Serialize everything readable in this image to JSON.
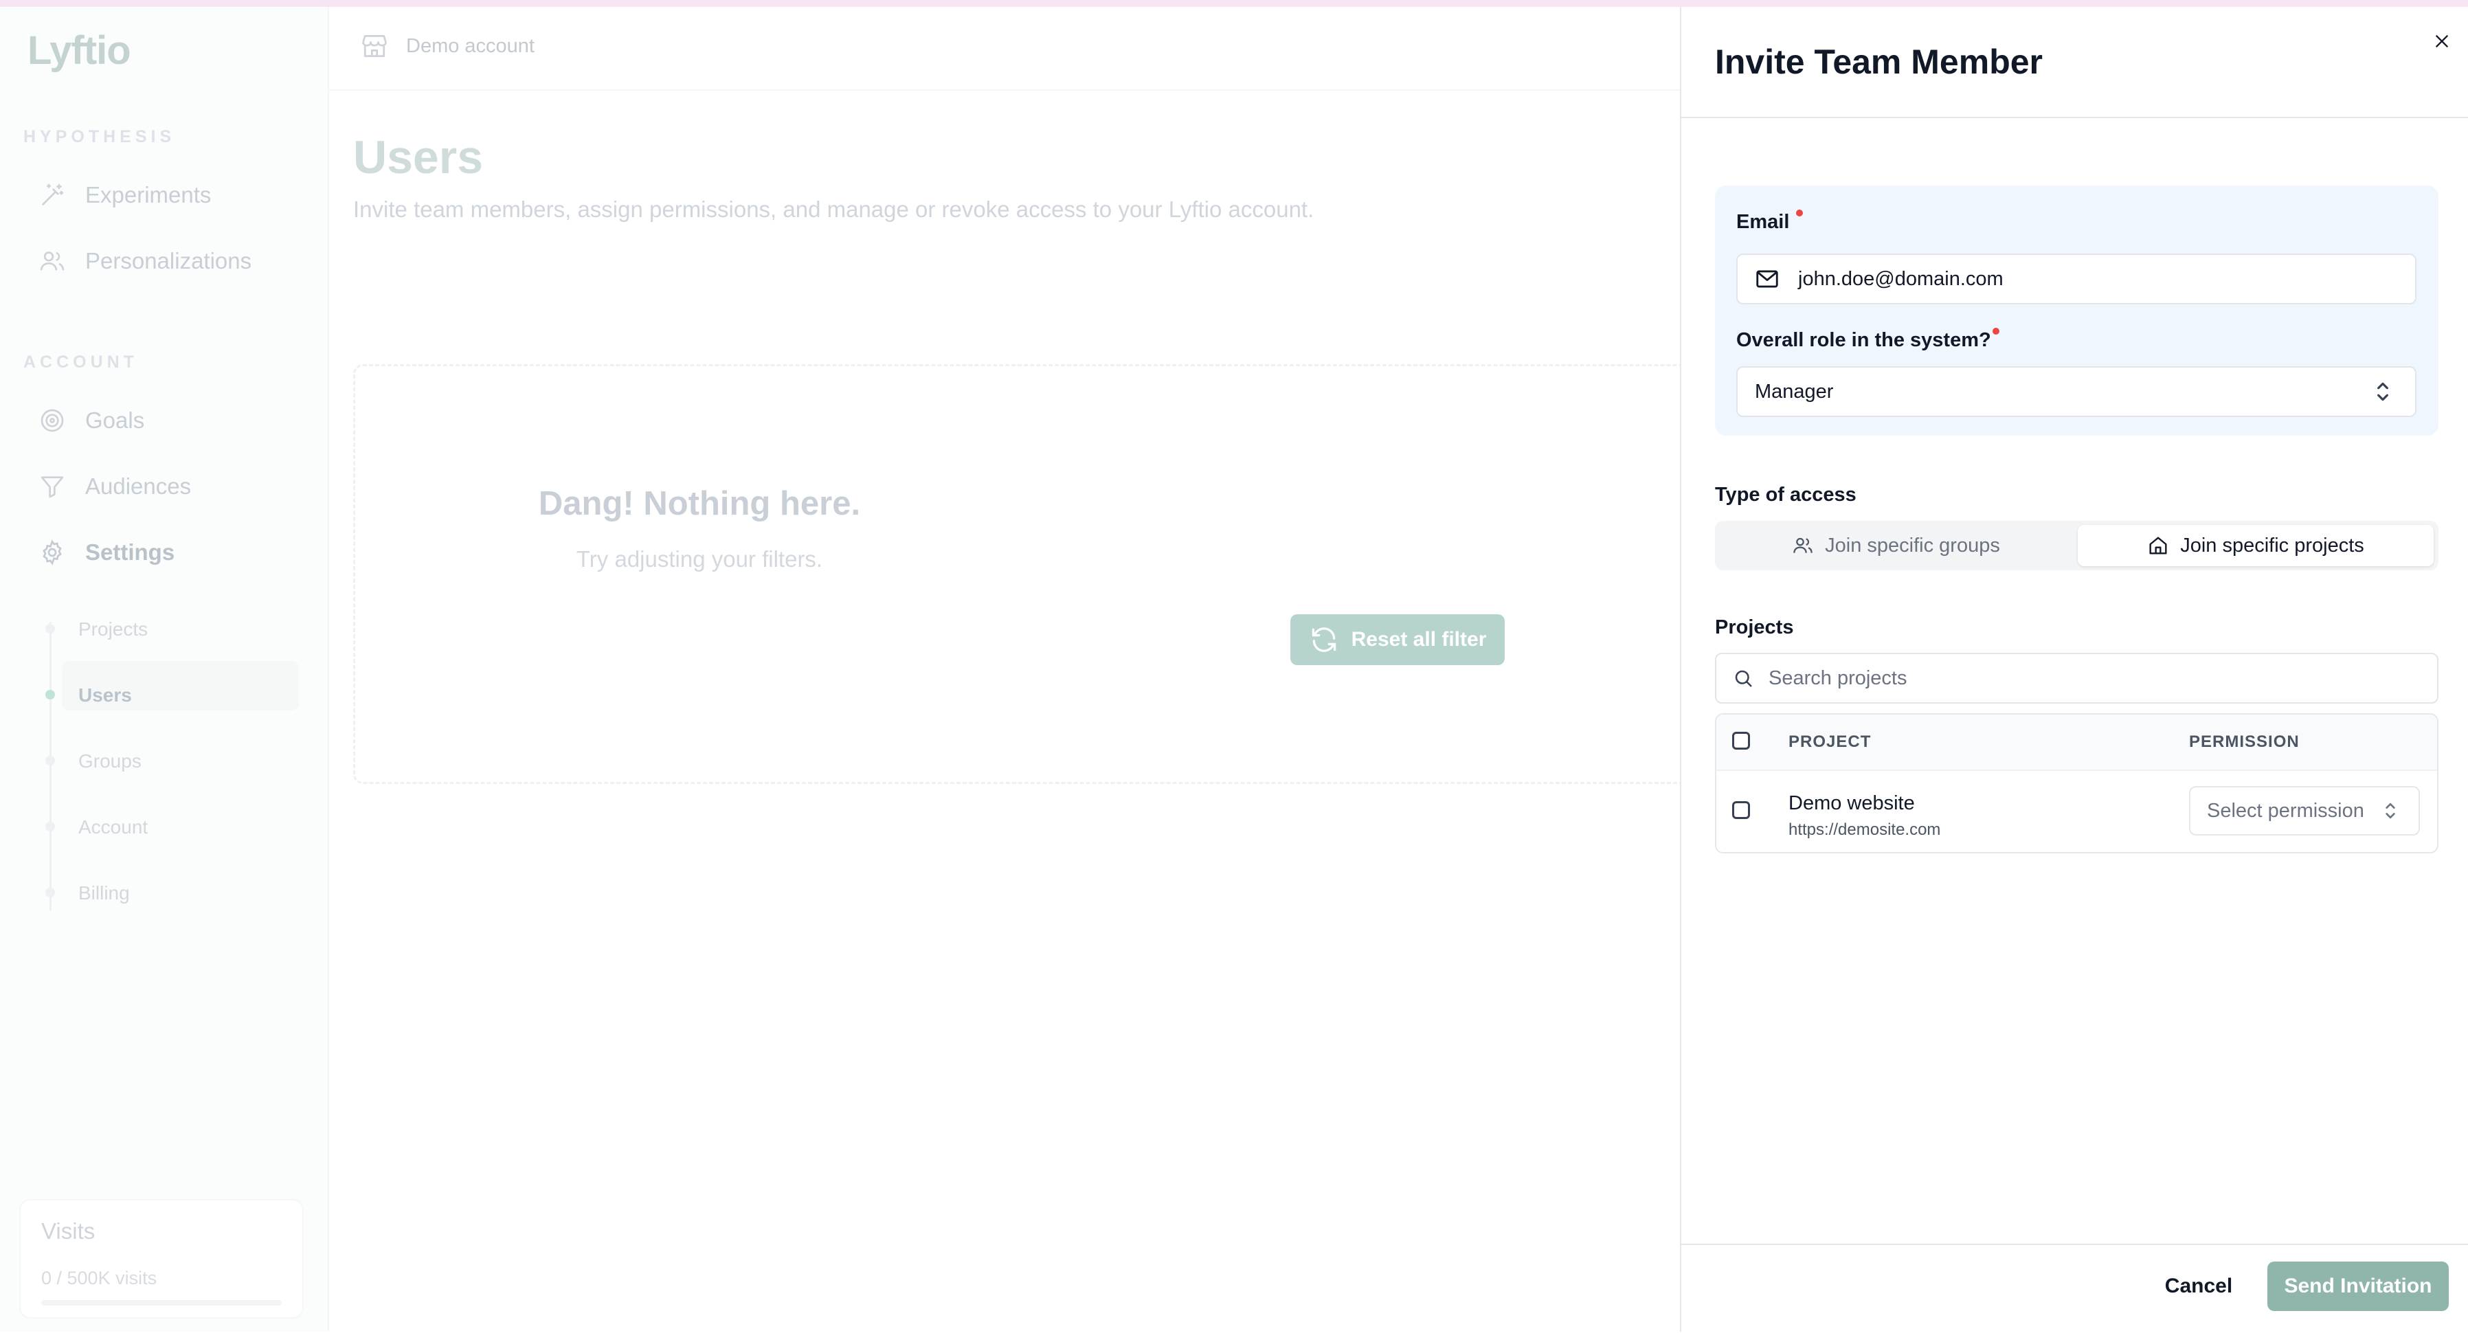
{
  "app": {
    "logo": "Lyftio",
    "sidebar": {
      "section_hypothesis": "HYPOTHESIS",
      "section_account": "ACCOUNT",
      "items": [
        {
          "label": "Experiments",
          "icon": "wand-icon"
        },
        {
          "label": "Personalizations",
          "icon": "users-icon"
        },
        {
          "label": "Goals",
          "icon": "target-icon"
        },
        {
          "label": "Audiences",
          "icon": "filter-icon"
        },
        {
          "label": "Settings",
          "icon": "gear-icon"
        }
      ],
      "settings_sub": [
        "Projects",
        "Users",
        "Groups",
        "Account",
        "Billing"
      ],
      "active_sub": "Users",
      "visits": {
        "title": "Visits",
        "usage": "0 / 500K visits",
        "progress": 0
      }
    },
    "topbar": {
      "account_name": "Demo account"
    },
    "page": {
      "title": "Users",
      "description": "Invite team members, assign permissions, and manage or revoke access to your Lyftio account.",
      "empty_title": "Dang! Nothing here.",
      "empty_subtitle": "Try adjusting your filters.",
      "reset_button": "Reset all filter"
    }
  },
  "panel": {
    "title": "Invite Team Member",
    "email_label": "Email",
    "email_value": "john.doe@domain.com",
    "role_label": "Overall role in the system?",
    "role_value": "Manager",
    "access_label": "Type of access",
    "access_options": [
      "Join specific groups",
      "Join specific projects"
    ],
    "access_selected": "Join specific projects",
    "projects_label": "Projects",
    "search_placeholder": "Search projects",
    "table": {
      "col_project": "PROJECT",
      "col_permission": "PERMISSION",
      "rows": [
        {
          "name": "Demo website",
          "url": "https://demosite.com",
          "permission_placeholder": "Select permission"
        }
      ]
    },
    "cancel_button": "Cancel",
    "send_button": "Send Invitation"
  },
  "colors": {
    "accent": "#8fb5ac",
    "required_dot": "#ef4444",
    "form_box_bg": "#eff6fd"
  }
}
